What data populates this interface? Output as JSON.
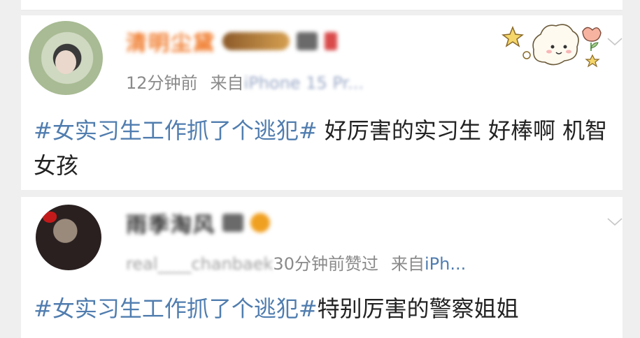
{
  "posts": [
    {
      "username": "清明尘黛",
      "time": "12分钟前",
      "source_prefix": "来自",
      "source_device": "iPhone 15 Pr...",
      "hashtag": "#女实习生工作抓了个逃犯#",
      "text": " 好厉害的实习生 好棒啊 机智女孩"
    },
    {
      "username": "雨季淘风",
      "liked_by": "real____chanbaek",
      "time_liked": "30分钟前赞过",
      "source_prefix": "来自",
      "source_device": "iPh...",
      "hashtag": "#女实习生工作抓了个逃犯#",
      "text": "特别厉害的警察姐姐"
    }
  ],
  "colors": {
    "hashtag": "#507daf",
    "meta": "#8a8a8a",
    "background": "#efefef"
  },
  "icons": [
    "avatar",
    "chevron-down-icon",
    "decorative-sticker-icon",
    "member-badge-icon"
  ]
}
